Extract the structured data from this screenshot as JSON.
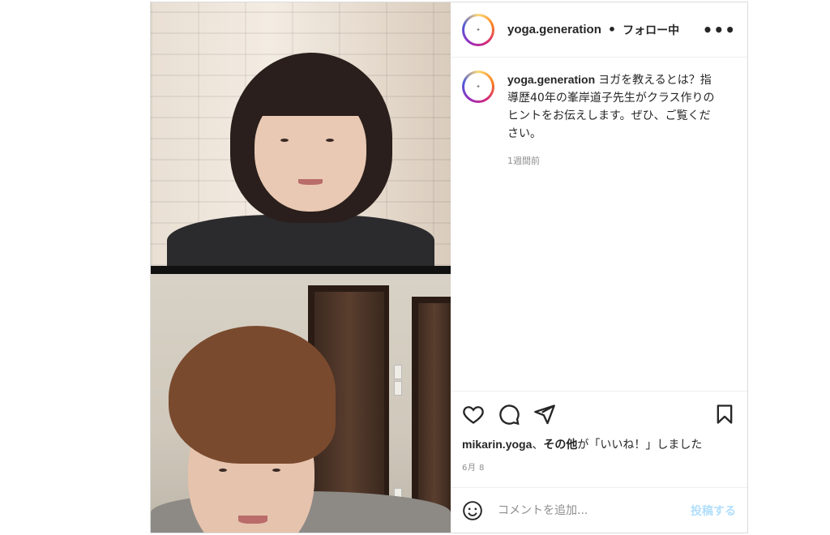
{
  "header": {
    "username": "yoga.generation",
    "separator": "•",
    "follow_status": "フォロー中",
    "more_label": "•••"
  },
  "caption": {
    "username": "yoga.generation",
    "text": "ヨガを教えるとは？指導歴40年の峯岸道子先生がクラス作りのヒントをお伝えします。ぜひ、ご覧ください。",
    "time": "1週間前"
  },
  "likes": {
    "user": "mikarin.yoga",
    "comma": "、",
    "others": "その他",
    "rest": "が「いいね！」しました"
  },
  "date": "6月 8",
  "comment": {
    "placeholder": "コメントを追加...",
    "post_label": "投稿する"
  },
  "icons": {
    "like": "heart-icon",
    "comment": "comment-icon",
    "share": "share-icon",
    "save": "bookmark-icon",
    "emoji": "emoji-icon"
  },
  "colors": {
    "post_button_disabled": "#b2dffc",
    "meta_gray": "#8e8e8e",
    "text": "#262626"
  }
}
